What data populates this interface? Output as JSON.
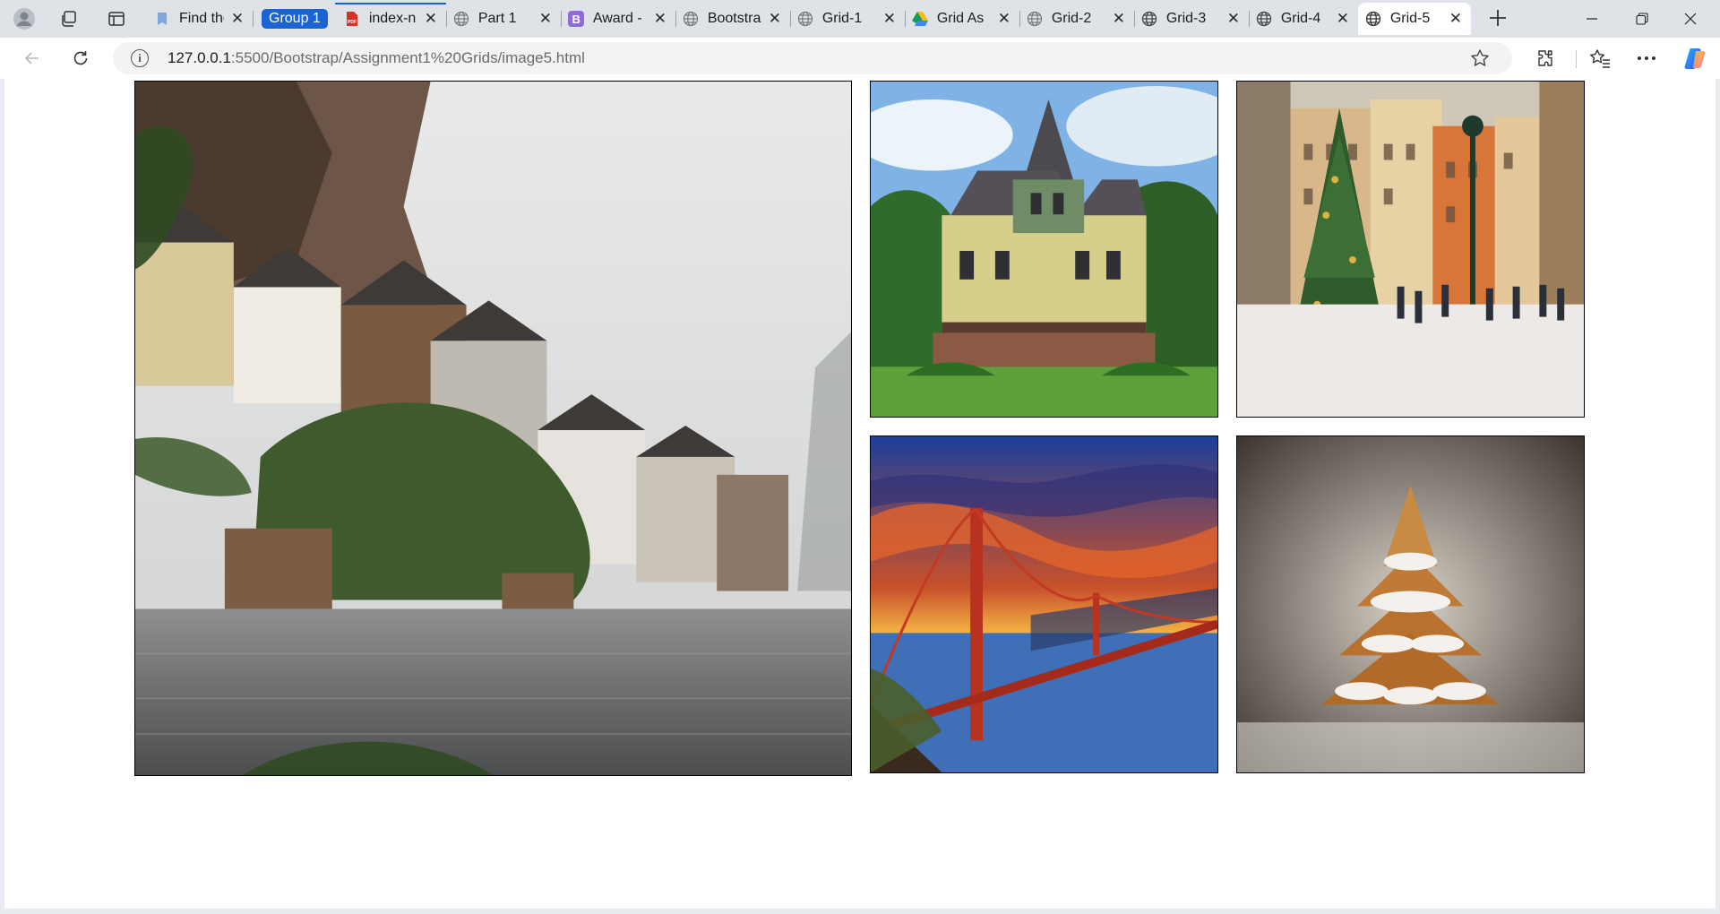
{
  "browser": {
    "tabs": [
      {
        "title": "Find the",
        "favicon": "bookmark-icon",
        "active": false
      },
      {
        "group_label": "Group 1",
        "title": "index-n",
        "favicon": "pdf-icon",
        "active": false
      },
      {
        "title": "Part 1",
        "favicon": "globe-icon",
        "active": false
      },
      {
        "title": "Award -",
        "favicon": "bootstrap-b-icon",
        "active": false
      },
      {
        "title": "Bootstra",
        "favicon": "globe-icon",
        "active": false
      },
      {
        "title": "Grid-1",
        "favicon": "globe-icon",
        "active": false
      },
      {
        "title": "Grid As",
        "favicon": "google-drive-icon",
        "active": false
      },
      {
        "title": "Grid-2",
        "favicon": "globe-icon",
        "active": false
      },
      {
        "title": "Grid-3",
        "favicon": "globe-icon",
        "active": false
      },
      {
        "title": "Grid-4",
        "favicon": "globe-icon",
        "active": false
      },
      {
        "title": "Grid-5",
        "favicon": "globe-icon",
        "active": true
      }
    ],
    "group_color": "#1a64d4",
    "new_tab_icon": "plus-icon",
    "window_controls": [
      "minimize-icon",
      "restore-icon",
      "close-icon"
    ],
    "address": {
      "host": "127.0.0.1",
      "path": ":5500/Bootstrap/Assignment1%20Grids/image5.html"
    },
    "toolbar_icons": [
      "back-arrow-icon",
      "reload-icon",
      "site-info-icon",
      "favorite-star-icon",
      "extensions-icon",
      "favorites-icon",
      "more-icon",
      "copilot-icon"
    ]
  },
  "page": {
    "images": [
      {
        "subject": "lakeside-village",
        "position": "left-large"
      },
      {
        "subject": "victorian-house",
        "position": "top-middle"
      },
      {
        "subject": "christmas-market-square",
        "position": "top-right"
      },
      {
        "subject": "golden-gate-sunset",
        "position": "bottom-middle"
      },
      {
        "subject": "sugar-dusted-cookie-tree",
        "position": "bottom-right"
      }
    ]
  }
}
